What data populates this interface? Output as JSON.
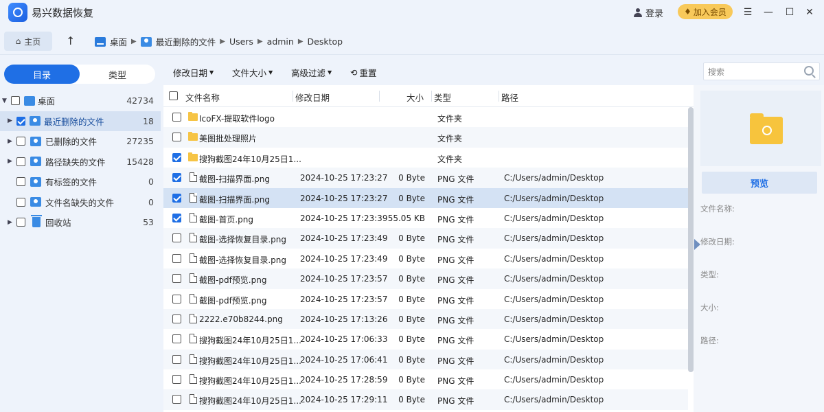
{
  "app": {
    "title": "易兴数据恢复",
    "login": "登录",
    "vip": "加入会员"
  },
  "window": {
    "menu_icon": "hamburger-icon",
    "minimize": "—",
    "maximize": "☐",
    "close": "✕"
  },
  "address": {
    "home_label": "主页",
    "crumbs": [
      "桌面",
      "最近删除的文件",
      "Users",
      "admin",
      "Desktop"
    ]
  },
  "left": {
    "tabs": [
      "目录",
      "类型"
    ],
    "tree": [
      {
        "label": "桌面",
        "count": "42734"
      },
      {
        "label": "最近删除的文件",
        "count": "18"
      },
      {
        "label": "已删除的文件",
        "count": "27235"
      },
      {
        "label": "路径缺失的文件",
        "count": "15428"
      },
      {
        "label": "有标签的文件",
        "count": "0"
      },
      {
        "label": "文件名缺失的文件",
        "count": "0"
      },
      {
        "label": "回收站",
        "count": "53"
      }
    ]
  },
  "toolbar": {
    "modified": "修改日期",
    "size": "文件大小",
    "advanced": "高级过滤",
    "reset": "重置",
    "search_placeholder": "搜索"
  },
  "list": {
    "headers": {
      "name": "文件名称",
      "date": "修改日期",
      "size": "大小",
      "type": "类型",
      "path": "路径"
    },
    "rows": [
      {
        "name": "IcoFX-提取软件logo",
        "date": "",
        "size": "",
        "type": "文件夹",
        "path": ""
      },
      {
        "name": "美图批处理照片",
        "date": "",
        "size": "",
        "type": "文件夹",
        "path": ""
      },
      {
        "name": "搜狗截图24年10月25日1...",
        "date": "",
        "size": "",
        "type": "文件夹",
        "path": ""
      },
      {
        "name": "截图-扫描界面.png",
        "date": "2024-10-25 17:23:27",
        "size": "0 Byte",
        "type": "PNG 文件",
        "path": "C:/Users/admin/Desktop"
      },
      {
        "name": "截图-扫描界面.png",
        "date": "2024-10-25 17:23:27",
        "size": "0 Byte",
        "type": "PNG 文件",
        "path": "C:/Users/admin/Desktop"
      },
      {
        "name": "截图-首页.png",
        "date": "2024-10-25 17:23:39",
        "size": "55.05 KB",
        "type": "PNG 文件",
        "path": "C:/Users/admin/Desktop"
      },
      {
        "name": "截图-选择恢复目录.png",
        "date": "2024-10-25 17:23:49",
        "size": "0 Byte",
        "type": "PNG 文件",
        "path": "C:/Users/admin/Desktop"
      },
      {
        "name": "截图-选择恢复目录.png",
        "date": "2024-10-25 17:23:49",
        "size": "0 Byte",
        "type": "PNG 文件",
        "path": "C:/Users/admin/Desktop"
      },
      {
        "name": "截图-pdf预览.png",
        "date": "2024-10-25 17:23:57",
        "size": "0 Byte",
        "type": "PNG 文件",
        "path": "C:/Users/admin/Desktop"
      },
      {
        "name": "截图-pdf预览.png",
        "date": "2024-10-25 17:23:57",
        "size": "0 Byte",
        "type": "PNG 文件",
        "path": "C:/Users/admin/Desktop"
      },
      {
        "name": "2222.e70b8244.png",
        "date": "2024-10-25 17:13:26",
        "size": "0 Byte",
        "type": "PNG 文件",
        "path": "C:/Users/admin/Desktop"
      },
      {
        "name": "搜狗截图24年10月25日1...",
        "date": "2024-10-25 17:06:33",
        "size": "0 Byte",
        "type": "PNG 文件",
        "path": "C:/Users/admin/Desktop"
      },
      {
        "name": "搜狗截图24年10月25日1...",
        "date": "2024-10-25 17:06:41",
        "size": "0 Byte",
        "type": "PNG 文件",
        "path": "C:/Users/admin/Desktop"
      },
      {
        "name": "搜狗截图24年10月25日1...",
        "date": "2024-10-25 17:28:59",
        "size": "0 Byte",
        "type": "PNG 文件",
        "path": "C:/Users/admin/Desktop"
      },
      {
        "name": "搜狗截图24年10月25日1...",
        "date": "2024-10-25 17:29:11",
        "size": "0 Byte",
        "type": "PNG 文件",
        "path": "C:/Users/admin/Desktop"
      }
    ]
  },
  "preview": {
    "button": "预览",
    "labels": [
      "文件名称:",
      "修改日期:",
      "类型:",
      "大小:",
      "路径:"
    ]
  },
  "colors": {
    "accent": "#1f6fe5",
    "selected_row": "#d4e2f4",
    "folder": "#f6c445",
    "vip": "#f8c95a"
  }
}
